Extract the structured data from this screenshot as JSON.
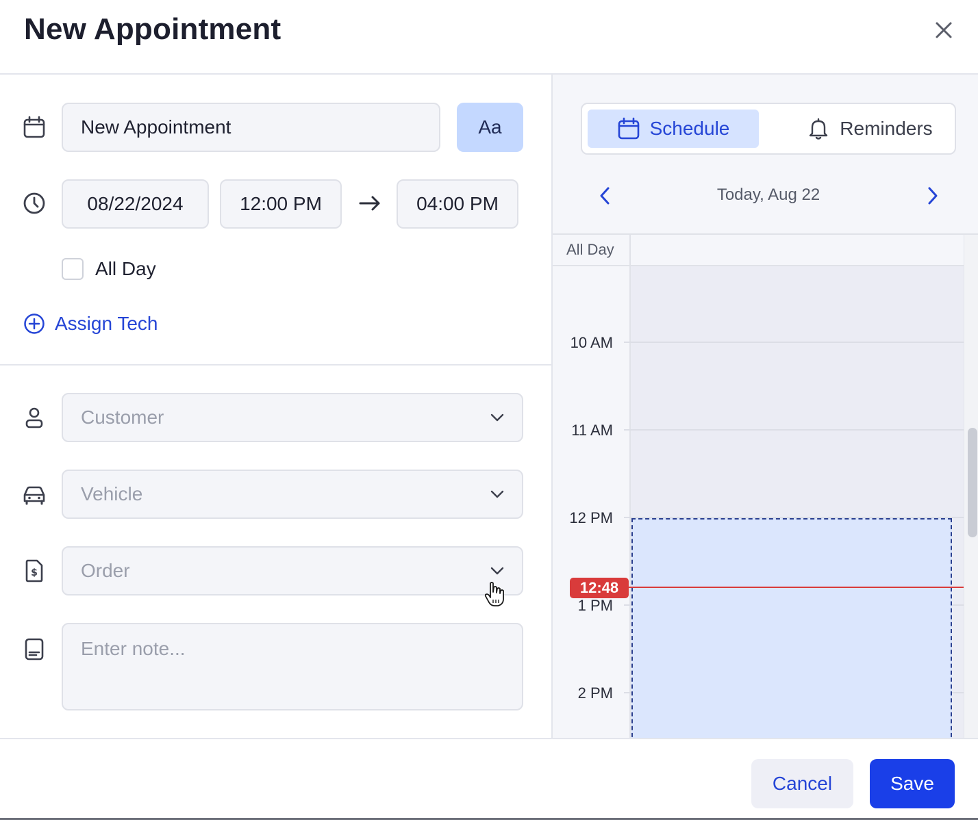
{
  "dialog": {
    "title": "New Appointment"
  },
  "form": {
    "title_value": "New Appointment",
    "font_button_label": "Aa",
    "date": "08/22/2024",
    "start_time": "12:00 PM",
    "end_time": "04:00 PM",
    "all_day_label": "All Day",
    "all_day_checked": false,
    "assign_tech_label": "Assign Tech",
    "customer_placeholder": "Customer",
    "vehicle_placeholder": "Vehicle",
    "order_placeholder": "Order",
    "note_placeholder": "Enter note..."
  },
  "panel": {
    "tabs": [
      {
        "label": "Schedule",
        "icon": "calendar-icon",
        "active": true
      },
      {
        "label": "Reminders",
        "icon": "bell-icon",
        "active": false
      }
    ],
    "date_label": "Today, Aug 22",
    "all_day_label": "All Day",
    "hours": [
      "10 AM",
      "11 AM",
      "12 PM",
      "1 PM",
      "2 PM"
    ],
    "now_badge": "12:48"
  },
  "footer": {
    "cancel_label": "Cancel",
    "save_label": "Save"
  },
  "colors": {
    "accent": "#2545d6",
    "primary_button": "#1a3fe8",
    "now_indicator": "#d93b3b",
    "event_fill": "#dbe6fd"
  }
}
